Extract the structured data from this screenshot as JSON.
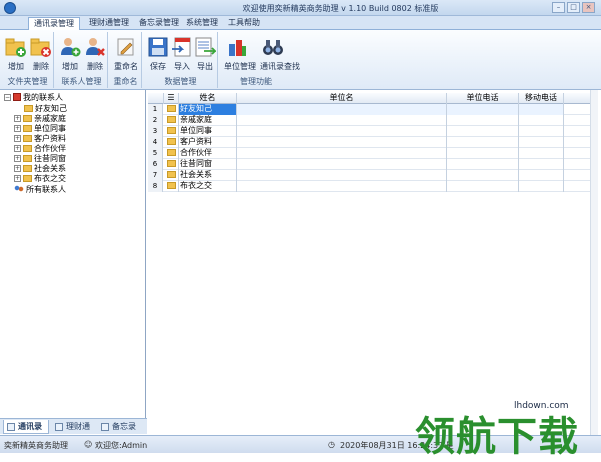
{
  "window": {
    "title": "欢迎使用奕新精英商务助理 v 1.10 Build 0802 标准版"
  },
  "menu": {
    "tabs": [
      "通讯录管理",
      "理财通管理",
      "备忘录管理",
      "系统管理",
      "工具帮助"
    ],
    "active": "通讯录管理"
  },
  "ribbon": {
    "groups": [
      {
        "label": "文件夹管理",
        "buttons": [
          {
            "label": "增加",
            "icon": "folder-add-icon"
          },
          {
            "label": "删除",
            "icon": "folder-delete-icon"
          }
        ]
      },
      {
        "label": "联系人管理",
        "buttons": [
          {
            "label": "增加",
            "icon": "contact-add-icon"
          },
          {
            "label": "删除",
            "icon": "contact-delete-icon"
          }
        ]
      },
      {
        "label": "重命名",
        "buttons": [
          {
            "label": "重命名",
            "icon": "rename-icon"
          }
        ]
      },
      {
        "label": "数据管理",
        "buttons": [
          {
            "label": "保存",
            "icon": "save-icon"
          },
          {
            "label": "导入",
            "icon": "import-icon"
          },
          {
            "label": "导出",
            "icon": "export-icon"
          }
        ]
      },
      {
        "label": "管理功能",
        "buttons": [
          {
            "label": "单位管理",
            "icon": "unit-manage-icon"
          },
          {
            "label": "通讯录查找",
            "icon": "binoculars-icon"
          }
        ]
      }
    ]
  },
  "tree": {
    "root": "我的联系人",
    "children": [
      "好友知己",
      "亲戚家庭",
      "单位同事",
      "客户资料",
      "合作伙伴",
      "往昔同窗",
      "社会关系",
      "布衣之交"
    ],
    "all": "所有联系人"
  },
  "left_tabs": [
    "通讯录",
    "理财通",
    "备忘录"
  ],
  "grid": {
    "columns": [
      "",
      "姓名",
      "单位名",
      "单位电话",
      "移动电话"
    ],
    "rows": [
      {
        "num": "1",
        "name": "好友知己"
      },
      {
        "num": "2",
        "name": "亲戚家庭"
      },
      {
        "num": "3",
        "name": "单位同事"
      },
      {
        "num": "4",
        "name": "客户资料"
      },
      {
        "num": "5",
        "name": "合作伙伴"
      },
      {
        "num": "6",
        "name": "往昔同窗"
      },
      {
        "num": "7",
        "name": "社会关系"
      },
      {
        "num": "8",
        "name": "布衣之交"
      }
    ]
  },
  "status": {
    "app": "奕新精英商务助理",
    "user": "欢迎您:Admin",
    "datetime": "2020年08月31日 16:24:37 星"
  },
  "watermark": {
    "text": "领航下载",
    "url": "lhdown.com"
  },
  "colors": {
    "accent": "#2d7fe0",
    "watermark": "#2a8f2e",
    "folder": "#f1c24e"
  }
}
